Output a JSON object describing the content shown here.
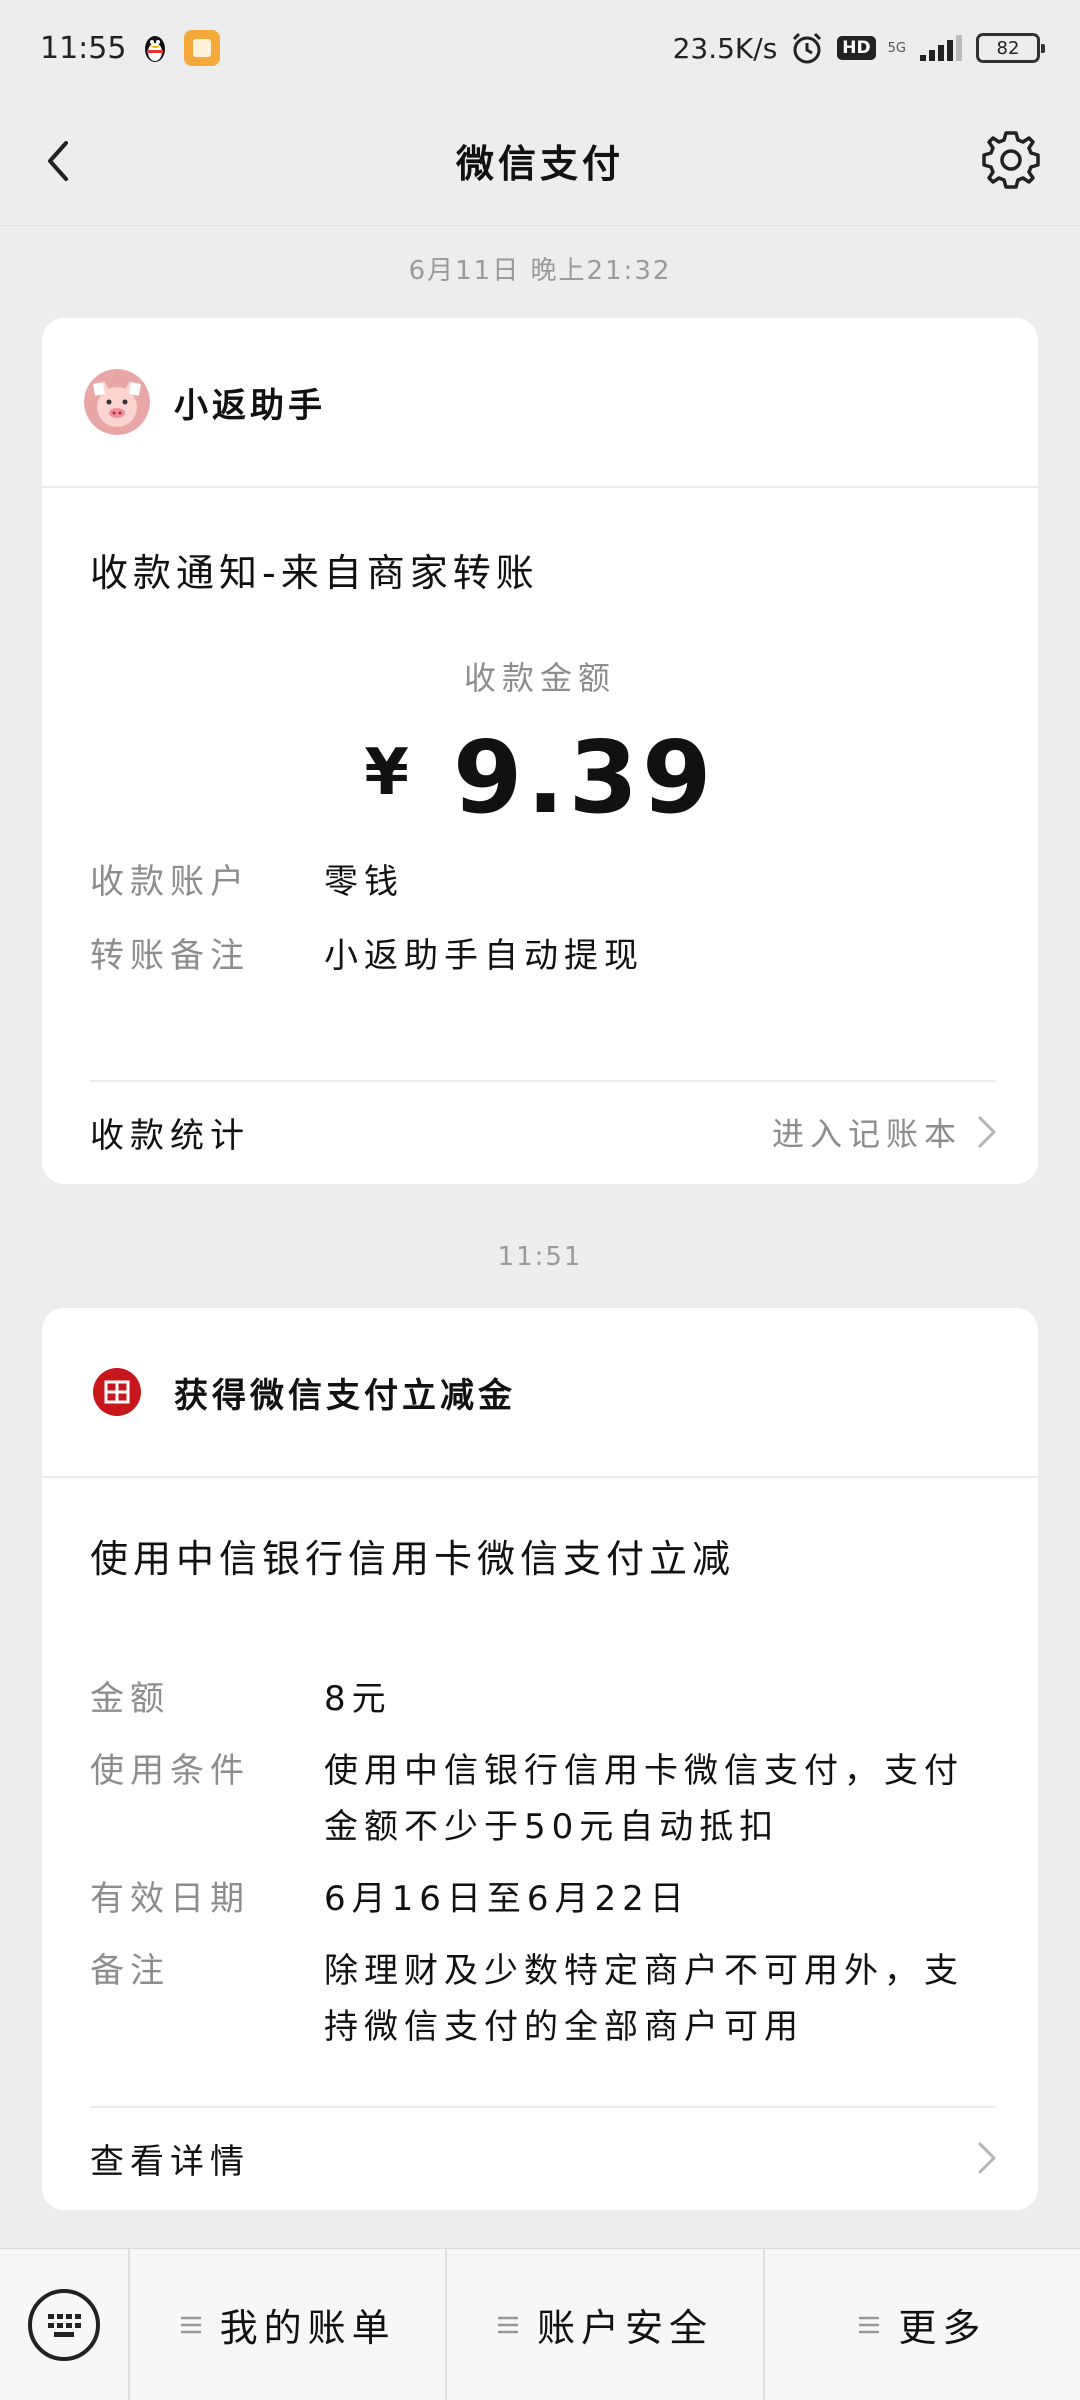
{
  "status_bar": {
    "time": "11:55",
    "network_speed": "23.5K/s",
    "hd": "HD",
    "signal": "5G",
    "battery": "82"
  },
  "nav": {
    "title": "微信支付"
  },
  "messages": [
    {
      "timestamp": "6月11日 晚上21:32",
      "sender": "小返助手",
      "title": "收款通知-来自商家转账",
      "amount_label": "收款金额",
      "currency_symbol": "¥",
      "amount": "9.39",
      "fields": [
        {
          "label": "收款账户",
          "value": "零钱"
        },
        {
          "label": "转账备注",
          "value": "小返助手自动提现"
        }
      ],
      "footer_left": "收款统计",
      "footer_right": "进入记账本"
    },
    {
      "timestamp": "11:51",
      "sender": "获得微信支付立减金",
      "title": "使用中信银行信用卡微信支付立减",
      "fields": [
        {
          "label": "金额",
          "value": "8元"
        },
        {
          "label": "使用条件",
          "value": "使用中信银行信用卡微信支付，支付金额不少于50元自动抵扣"
        },
        {
          "label": "有效日期",
          "value": "6月16日至6月22日"
        },
        {
          "label": "备注",
          "value": "除理财及少数特定商户不可用外，支持微信支付的全部商户可用"
        }
      ],
      "footer_left": "查看详情"
    }
  ],
  "bottom_menu": {
    "items": [
      "我的账单",
      "账户安全",
      "更多"
    ]
  },
  "icons": {
    "back": "chevron-left-icon",
    "settings": "gear-icon",
    "keyboard": "keyboard-icon",
    "avatar1": "pig-avatar",
    "avatar2": "citic-bank-logo"
  },
  "colors": {
    "background": "#ededed",
    "card": "#ffffff",
    "muted_text": "#8d8d8d",
    "citic_red": "#c8161d"
  }
}
